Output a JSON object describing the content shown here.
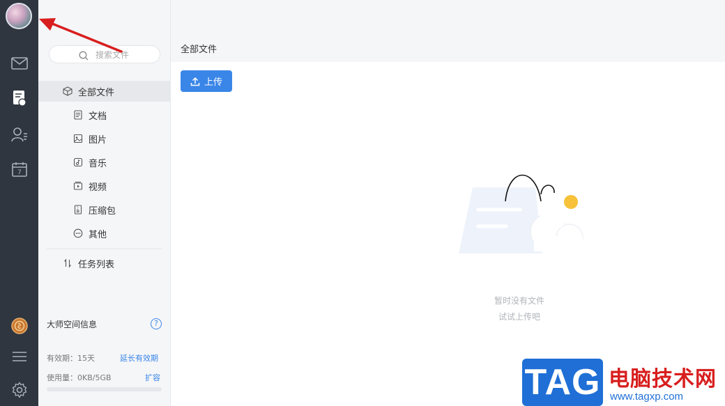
{
  "nav": {
    "search_placeholder": "搜索文件",
    "items": [
      {
        "label": "全部文件",
        "icon": "box-icon"
      },
      {
        "label": "文档",
        "icon": "document-icon"
      },
      {
        "label": "图片",
        "icon": "image-icon"
      },
      {
        "label": "音乐",
        "icon": "music-icon"
      },
      {
        "label": "视频",
        "icon": "video-icon"
      },
      {
        "label": "压缩包",
        "icon": "archive-icon"
      },
      {
        "label": "其他",
        "icon": "more-icon"
      }
    ],
    "tasks_label": "任务列表"
  },
  "space": {
    "title": "大师空间信息",
    "help": "?",
    "validity_label": "有效期：15天",
    "extend_link": "延长有效期",
    "usage_label": "使用量：0KB/5GB",
    "expand_link": "扩容",
    "usage_fraction": 0
  },
  "main": {
    "title": "全部文件",
    "upload_label": "上传",
    "empty_line1": "暂时没有文件",
    "empty_line2": "试试上传吧"
  },
  "watermark": {
    "tag": "TAG",
    "cn": "电脑技术网",
    "url": "www.tagxp.com"
  },
  "colors": {
    "accent": "#3a86e8",
    "rail": "#2f3640",
    "arrow": "#d81e1e"
  }
}
